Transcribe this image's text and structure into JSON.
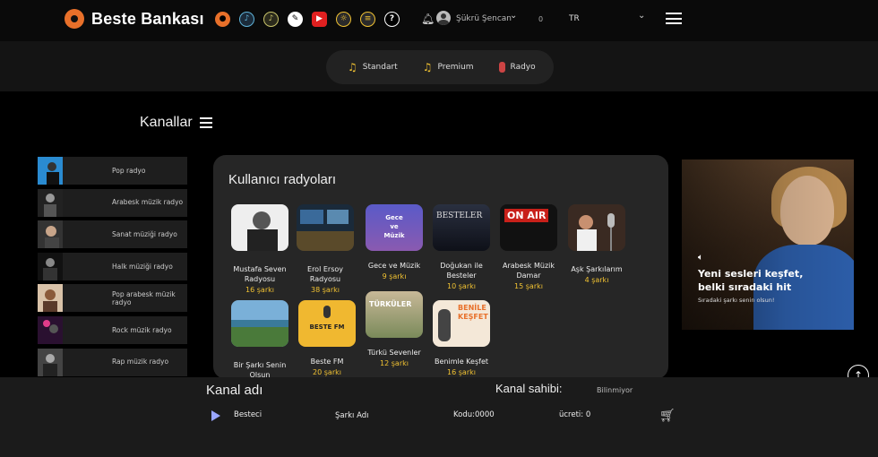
{
  "brand": {
    "name": "Beste Bankası",
    "accent": "#e8702a"
  },
  "header_icons": [
    "disc-icon",
    "music-note-icon",
    "music-note-icon",
    "pen-icon",
    "youtube-icon",
    "lightbulb-icon",
    "lyrics-icon",
    "help-icon"
  ],
  "user": {
    "name": "Şükrü Şencan",
    "notification_count": "0"
  },
  "language": "TR",
  "modes": [
    {
      "label": "Standart",
      "icon": "music-note-icon"
    },
    {
      "label": "Premium",
      "icon": "music-note-icon"
    },
    {
      "label": "Radyo",
      "icon": "microphone-icon"
    }
  ],
  "channels_title": "Kanallar",
  "channels": [
    {
      "label": "Pop radyo"
    },
    {
      "label": "Arabesk müzik radyo"
    },
    {
      "label": "Sanat müziği radyo"
    },
    {
      "label": "Halk müziği radyo"
    },
    {
      "label": "Pop arabesk müzik radyo"
    },
    {
      "label": "Rock müzik radyo"
    },
    {
      "label": "Rap müzik radyo"
    }
  ],
  "user_radios": {
    "title": "Kullanıcı radyoları",
    "items": [
      {
        "name": "Mustafa Seven Radyosu",
        "count": "16 şarkı"
      },
      {
        "name": "Erol Ersoy Radyosu",
        "count": "38 şarkı"
      },
      {
        "name": "Gece ve Müzik",
        "count": "9 şarkı",
        "cover_text": "Gece ve Müzik"
      },
      {
        "name": "Doğukan ile Besteler",
        "count": "10 şarkı",
        "cover_text": "BESTELER"
      },
      {
        "name": "Arabesk Müzik Damar",
        "count": "15 şarkı",
        "cover_text": "ON AIR"
      },
      {
        "name": "Aşk Şarkılarım",
        "count": "4 şarkı"
      },
      {
        "name": "Bir Şarkı Senin Olsun",
        "count": ""
      },
      {
        "name": "Beste FM",
        "count": "20 şarkı",
        "cover_text": "BESTE FM"
      },
      {
        "name": "Türkü Sevenler",
        "count": "12 şarkı",
        "cover_text": "TÜRKÜLER"
      },
      {
        "name": "Benimle Keşfet",
        "count": "16 şarkı",
        "cover_text": "BENİLE KEŞFET"
      }
    ]
  },
  "promo": {
    "title": "Yeni sesleri keşfet, belki sıradaki hit",
    "subtitle": "Sıradaki şarkı senin olsun!"
  },
  "player": {
    "channel_label": "Kanal adı",
    "owner_label": "Kanal sahibi:",
    "owner_value": "Bilinmiyor",
    "composer": "Besteci",
    "song": "Şarkı Adı",
    "code": "Kodu:0000",
    "fee": "ücreti: 0"
  }
}
